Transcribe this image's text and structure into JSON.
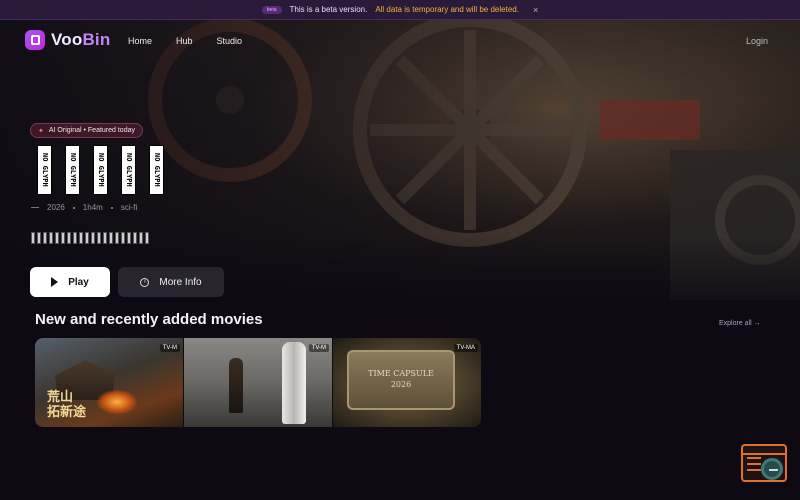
{
  "beta_banner": {
    "pill": "beta",
    "text": "This is a beta version.",
    "warning": "All data is temporary and will be deleted.",
    "close": "×"
  },
  "nav": {
    "logo_prefix": "Voo",
    "logo_suffix": "Bin",
    "links": [
      "Home",
      "Hub",
      "Studio"
    ],
    "login": "Login"
  },
  "hero": {
    "badge": "AI Original • Featured today",
    "badge_icon": "sparkle-icon",
    "title_glyphs": [
      "NO GLYPH",
      "NO GLYPH",
      "NO GLYPH",
      "NO GLYPH",
      "NO GLYPH"
    ],
    "year": "2026",
    "duration": "1h4m",
    "genre": "sci-fi",
    "play_label": "Play",
    "info_label": "More Info"
  },
  "section": {
    "title": "New and recently added movies",
    "explore": "Explore all →"
  },
  "cards": [
    {
      "rating": "TV-M",
      "overlay": "荒山\n拓新途"
    },
    {
      "rating": "TV-M",
      "overlay": ""
    },
    {
      "rating": "TV-MA",
      "overlay": "TIME CAPSULE\n2026"
    }
  ],
  "colors": {
    "accent": "#a855f7",
    "warning": "#f2b23a",
    "widget": "#e0702a"
  }
}
